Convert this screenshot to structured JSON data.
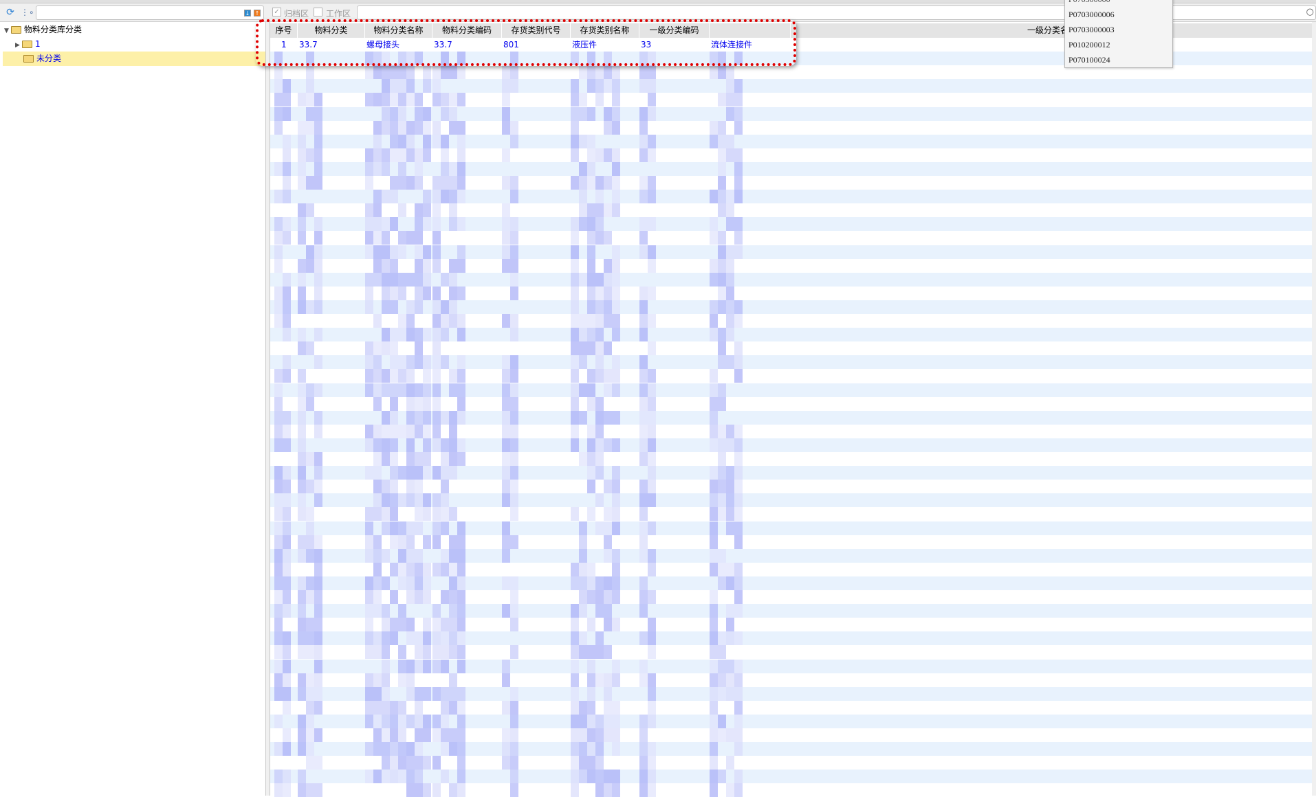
{
  "toolbar": {
    "refresh_icon": "refresh-icon",
    "tree_icon": "tree-structure-icon",
    "search_placeholder": "",
    "archive_label": "归档区",
    "archive_checked": true,
    "work_label": "工作区",
    "work_checked": false
  },
  "tree": {
    "root": "物料分类库分类",
    "children": [
      {
        "label": "1"
      },
      {
        "label": "未分类",
        "selected": true
      }
    ]
  },
  "grid": {
    "columns": [
      "序号",
      "物料分类",
      "物料分类名称",
      "物料分类编码",
      "存货类别代号",
      "存货类别名称",
      "一级分类编码",
      "",
      "一级分类名称"
    ],
    "rows": [
      [
        "1",
        "33.7",
        "螺母接头",
        "33.7",
        "801",
        "液压件",
        "33",
        "流体连接件",
        ""
      ]
    ]
  },
  "dropdown": {
    "items": [
      "P0703000006",
      "P0703000003",
      "P010200012",
      "P070100024"
    ]
  },
  "colors": {
    "link": "#0000ee",
    "selected": "#fdf0a8",
    "stripe": "#e8f2fd",
    "highlight": "#e00000"
  }
}
